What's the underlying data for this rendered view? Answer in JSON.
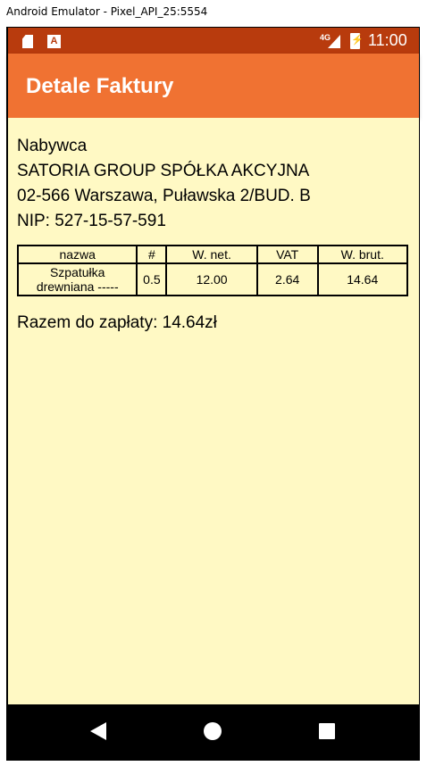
{
  "window": {
    "title": "Android Emulator - Pixel_API_25:5554"
  },
  "status_bar": {
    "time": "11:00",
    "network": "4G"
  },
  "app_bar": {
    "title": "Detale Faktury"
  },
  "buyer": {
    "heading": "Nabywca",
    "name": "SATORIA GROUP SPÓŁKA AKCYJNA",
    "address": "02-566 Warszawa, Puławska 2/BUD. B",
    "nip": "NIP: 527-15-57-591"
  },
  "table": {
    "headers": [
      "nazwa",
      "#",
      "W. net.",
      "VAT",
      "W. brut."
    ],
    "rows": [
      {
        "name_line1": "Szpatułka",
        "name_line2": "drewniana -----",
        "qty": "0.5",
        "net": "12.00",
        "vat": "2.64",
        "gross": "14.64"
      }
    ]
  },
  "total": "Razem do zapłaty: 14.64zł"
}
